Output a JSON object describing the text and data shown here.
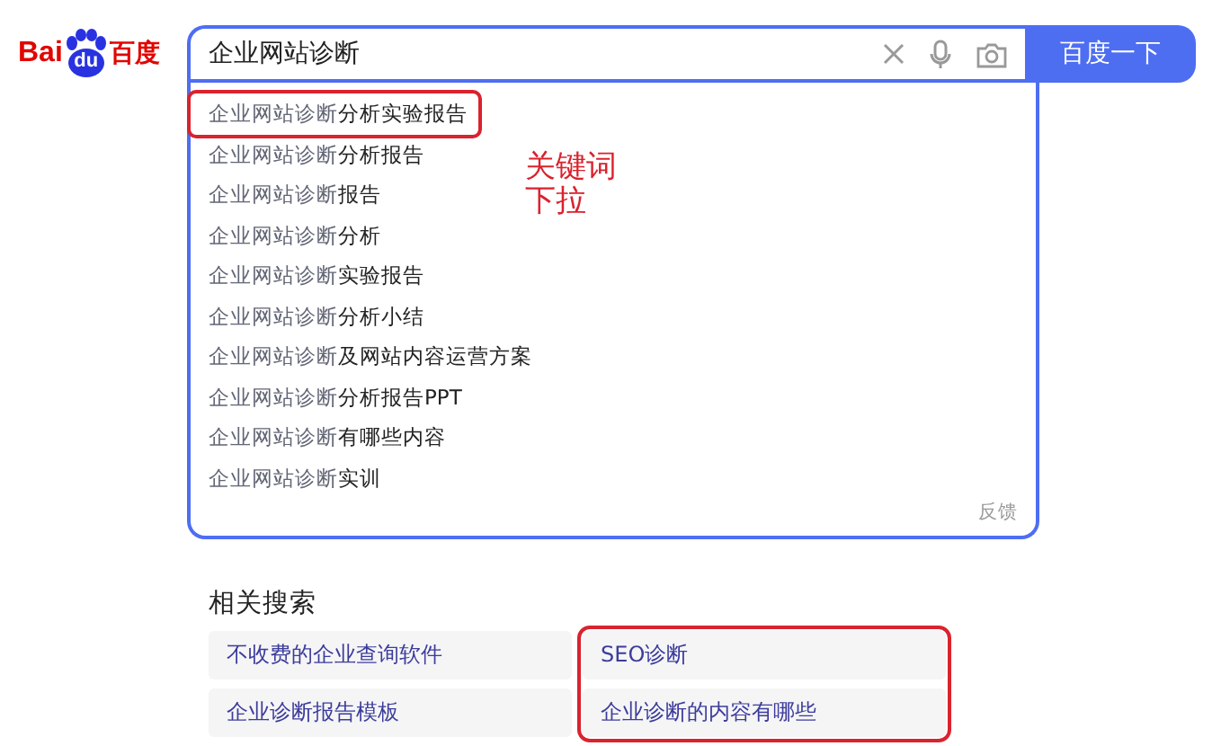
{
  "logo": {
    "parts": [
      "Bai",
      "du",
      "百度"
    ]
  },
  "search": {
    "value": "企业网站诊断",
    "button": "百度一下"
  },
  "suggestions": [
    {
      "text": "企业网站诊断**分析实验报告**",
      "highlighted": true
    },
    {
      "text": "企业网站诊断**分析报告**",
      "highlighted": false
    },
    {
      "text": "企业网站诊断**报告**",
      "highlighted": false
    },
    {
      "text": "企业网站诊断**分析**",
      "highlighted": false
    },
    {
      "text": "企业网站诊断**实验报告**",
      "highlighted": false
    },
    {
      "text": "企业网站诊断**分析小结**",
      "highlighted": false
    },
    {
      "text": "企业网站诊断**及网站内容运营方案**",
      "highlighted": false
    },
    {
      "text": "企业网站诊断**分析报告PPT**",
      "highlighted": false
    },
    {
      "text": "企业网站诊断**有哪些内容**",
      "highlighted": false
    },
    {
      "text": "企业网站诊断**实训**",
      "highlighted": false
    }
  ],
  "feedback": "反馈",
  "annotation": {
    "lines": [
      "关键词",
      "下拉"
    ]
  },
  "related_searches": {
    "title": "相关搜索",
    "columns": [
      {
        "highlighted": false,
        "items": [
          "不收费的企业查询软件",
          "企业诊断报告模板"
        ]
      },
      {
        "highlighted": true,
        "items": [
          "SEO诊断",
          "企业诊断的内容有哪些"
        ]
      }
    ]
  }
}
